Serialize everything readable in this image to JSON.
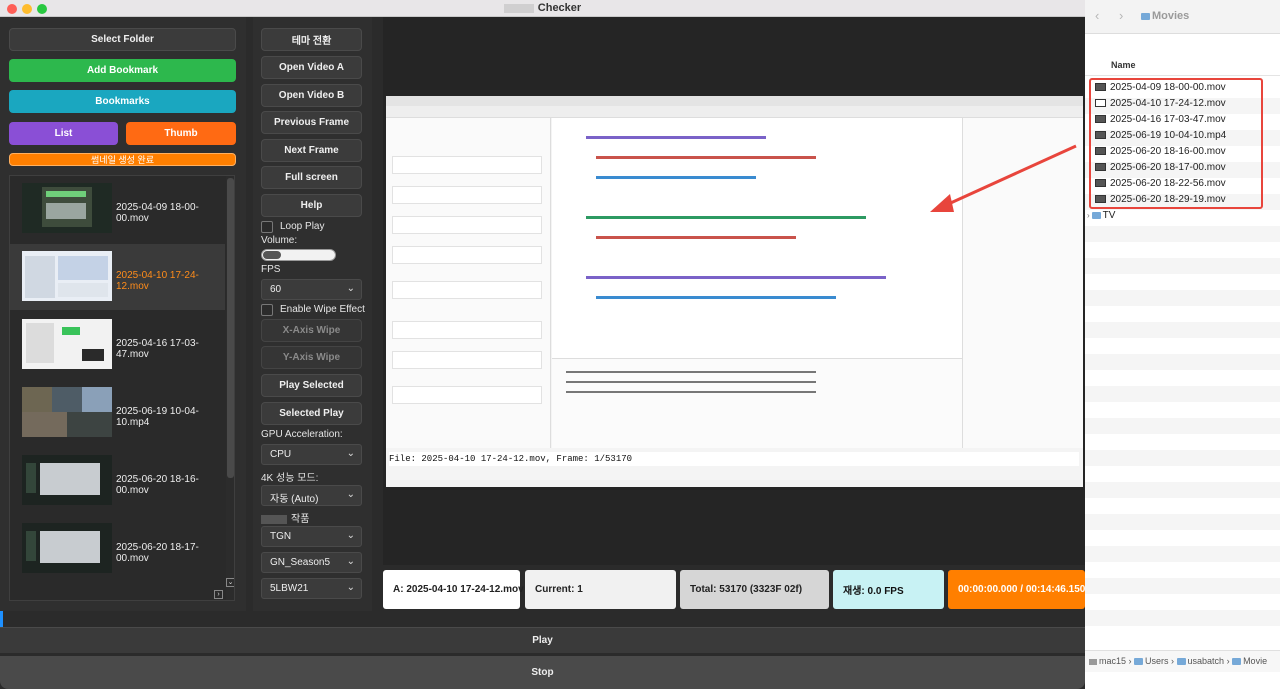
{
  "window": {
    "title": "Checker"
  },
  "left_panel": {
    "select_folder": "Select Folder",
    "add_bookmark": "Add Bookmark",
    "bookmarks": "Bookmarks",
    "list": "List",
    "thumb": "Thumb",
    "status": "썸네일 생성 완료",
    "files": [
      {
        "name": "2025-04-09 18-00-00.mov",
        "selected": false
      },
      {
        "name": "2025-04-10 17-24-12.mov",
        "selected": true
      },
      {
        "name": "2025-04-16 17-03-47.mov",
        "selected": false
      },
      {
        "name": "2025-06-19 10-04-10.mp4",
        "selected": false
      },
      {
        "name": "2025-06-20 18-16-00.mov",
        "selected": false
      },
      {
        "name": "2025-06-20 18-17-00.mov",
        "selected": false
      }
    ]
  },
  "controls": {
    "theme": "테마 전환",
    "open_a": "Open Video A",
    "open_b": "Open Video B",
    "prev_frame": "Previous Frame",
    "next_frame": "Next Frame",
    "fullscreen": "Full screen",
    "help": "Help",
    "loop_play": "Loop Play",
    "volume_label": "Volume:",
    "volume_level": 0.25,
    "fps_label": "FPS",
    "fps_value": "60",
    "wipe_effect": "Enable Wipe Effect",
    "x_wipe": "X-Axis Wipe",
    "y_wipe": "Y-Axis Wipe",
    "play_selected": "Play Selected",
    "selected_play": "Selected Play",
    "gpu_label": "GPU Acceleration:",
    "gpu_value": "CPU",
    "perf_label": "4K 성능 모드:",
    "perf_value": "자동 (Auto)",
    "works_label": "작품",
    "work_value": "TGN",
    "season_value": "GN_Season5",
    "episode_value": "5LBW21"
  },
  "video": {
    "overlay": "File: 2025-04-10 17-24-12.mov, Frame: 1/53170"
  },
  "status_bar": {
    "file": "A: 2025-04-10 17-24-12.mov",
    "current": "Current: 1",
    "total": "Total: 53170 (3323F 02f)",
    "fps": "재생: 0.0 FPS",
    "time": "00:00:00.000 / 00:14:46.150"
  },
  "playback": {
    "play": "Play",
    "stop": "Stop",
    "progress": 0.0
  },
  "colors": {
    "green": "#2db84d",
    "cyan": "#1aa7c0",
    "purple": "#8a4fd6",
    "orange": "#ff6a13",
    "status_orange": "#ff7f00"
  },
  "finder": {
    "title": "Movies",
    "column_name": "Name",
    "files": [
      "2025-04-09 18-00-00.mov",
      "2025-04-10 17-24-12.mov",
      "2025-04-16 17-03-47.mov",
      "2025-06-19 10-04-10.mp4",
      "2025-06-20 18-16-00.mov",
      "2025-06-20 18-17-00.mov",
      "2025-06-20 18-22-56.mov",
      "2025-06-20 18-29-19.mov"
    ],
    "folder": "TV",
    "path": [
      "mac15",
      "Users",
      "usabatch",
      "Movie"
    ]
  }
}
